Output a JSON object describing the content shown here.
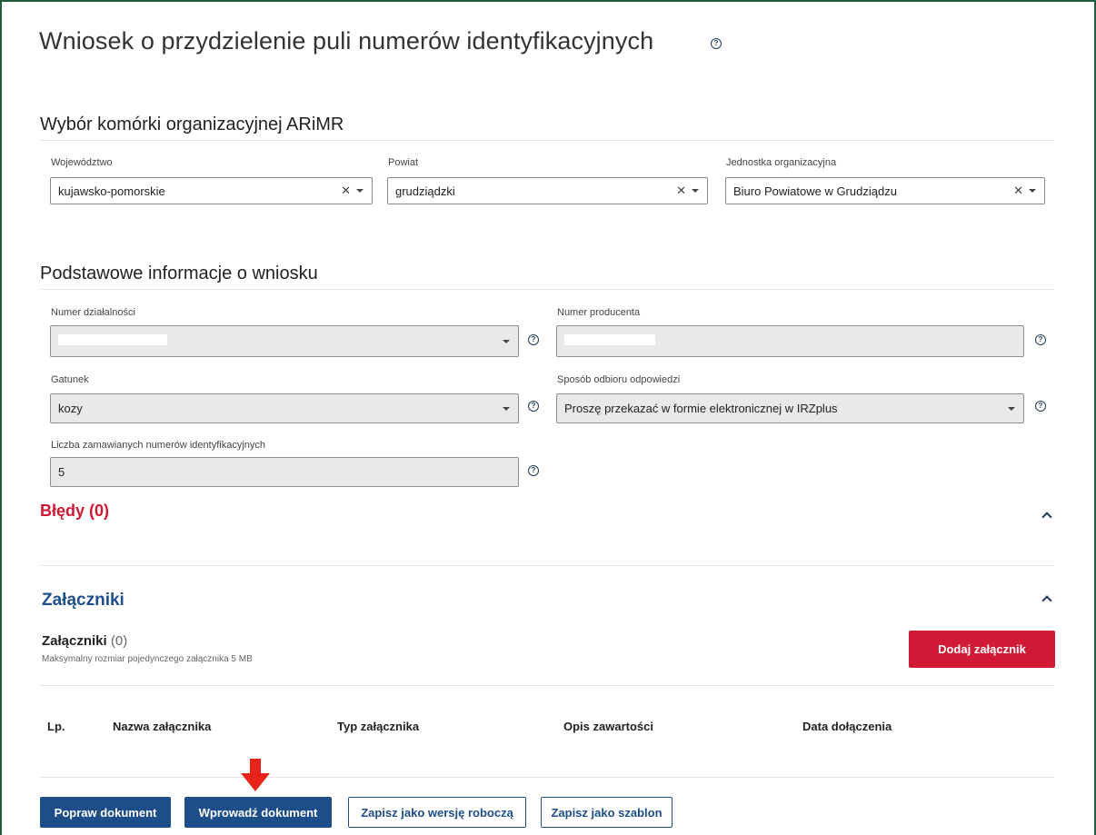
{
  "page": {
    "title": "Wniosek o przydzielenie puli numerów identyfikacyjnych"
  },
  "org_section": {
    "title": "Wybór komórki organizacyjnej ARiMR",
    "fields": [
      {
        "label": "Województwo",
        "value": "kujawsko-pomorskie"
      },
      {
        "label": "Powiat",
        "value": "grudziądzki"
      },
      {
        "label": "Jednostka organizacyjna",
        "value": "Biuro Powiatowe w Grudziądzu"
      }
    ]
  },
  "basic_section": {
    "title": "Podstawowe informacje o wniosku",
    "activity_number": {
      "label": "Numer działalności",
      "value": ""
    },
    "producer_number": {
      "label": "Numer producenta",
      "value": ""
    },
    "species": {
      "label": "Gatunek",
      "value": "kozy"
    },
    "response_method": {
      "label": "Sposób odbioru odpowiedzi",
      "value": "Proszę przekazać w formie elektronicznej w IRZplus"
    },
    "quantity": {
      "label": "Liczba zamawianych numerów identyfikacyjnych",
      "value": "5"
    }
  },
  "errors": {
    "title": "Błędy (0)"
  },
  "attachments": {
    "section_title": "Załączniki",
    "sub_title": "Załączniki",
    "count": "(0)",
    "note": "Maksymalny rozmiar pojedynczego załącznika 5 MB",
    "add_button": "Dodaj załącznik",
    "columns": [
      "Lp.",
      "Nazwa załącznika",
      "Typ załącznika",
      "Opis zawartości",
      "Data dołączenia"
    ]
  },
  "actions": {
    "correct": "Popraw dokument",
    "submit": "Wprowadź dokument",
    "save_draft": "Zapisz jako wersję roboczą",
    "save_template": "Zapisz jako szablon"
  },
  "colors": {
    "primary": "#1d4e89",
    "danger": "#d11a35",
    "frame": "#1f5c3a"
  }
}
